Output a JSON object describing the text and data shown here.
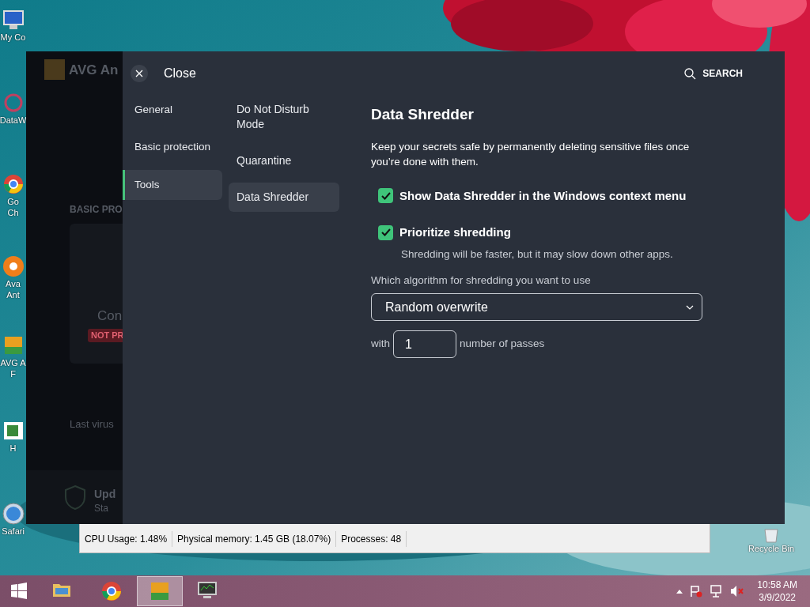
{
  "desktop_icons": [
    {
      "kind": "computer",
      "label_lines": [
        "My Co"
      ]
    },
    {
      "kind": "data",
      "label_lines": [
        "DataW"
      ]
    },
    {
      "kind": "chrome",
      "label_lines": [
        "Go",
        "Ch"
      ]
    },
    {
      "kind": "avast",
      "label_lines": [
        "Ava",
        "Ant"
      ]
    },
    {
      "kind": "avg",
      "label_lines": [
        "AVG A",
        "F"
      ]
    },
    {
      "kind": "hx",
      "label_lines": [
        "H"
      ]
    },
    {
      "kind": "safari",
      "label_lines": [
        "Safari"
      ]
    }
  ],
  "avg_main": {
    "title": "AVG An",
    "section": "BASIC PRO",
    "card_title": "Con",
    "card_badge": "NOT PR",
    "last_scan": "Last virus",
    "update_title": "Upd",
    "update_sub": "Sta"
  },
  "settings": {
    "close_label": "Close",
    "search_label": "SEARCH",
    "categories": [
      {
        "label": "General",
        "selected": false
      },
      {
        "label": "Basic protection",
        "selected": false
      },
      {
        "label": "Tools",
        "selected": true
      }
    ],
    "subcategories": [
      {
        "label": "Do Not Disturb Mode",
        "selected": false
      },
      {
        "label": "Quarantine",
        "selected": false
      },
      {
        "label": "Data Shredder",
        "selected": true
      }
    ],
    "title": "Data Shredder",
    "description": "Keep your secrets safe by permanently deleting sensitive files once you’re done with them.",
    "options": [
      {
        "label": "Show Data Shredder in the Windows context menu",
        "checked": true
      },
      {
        "label": "Prioritize shredding",
        "checked": true,
        "note": "Shredding will be faster, but it may slow down other apps."
      }
    ],
    "algorithm_label": "Which algorithm for shredding you want to use",
    "algorithm": "Random overwrite",
    "passes_prefix": "with",
    "passes": "1",
    "passes_suffix": "number of passes"
  },
  "task_manager": {
    "status": [
      "CPU Usage: 1.48%",
      "Physical memory: 1.45 GB (18.07%)",
      "Processes: 48"
    ]
  },
  "recycle_bin": {
    "label": "Recycle Bin"
  },
  "taskbar": {
    "apps": [
      {
        "kind": "explorer",
        "selected": false
      },
      {
        "kind": "chrome",
        "selected": false
      },
      {
        "kind": "avg",
        "selected": true
      },
      {
        "kind": "taskmgr",
        "selected": false
      }
    ],
    "time": "10:58 AM",
    "date": "3/9/2022"
  }
}
